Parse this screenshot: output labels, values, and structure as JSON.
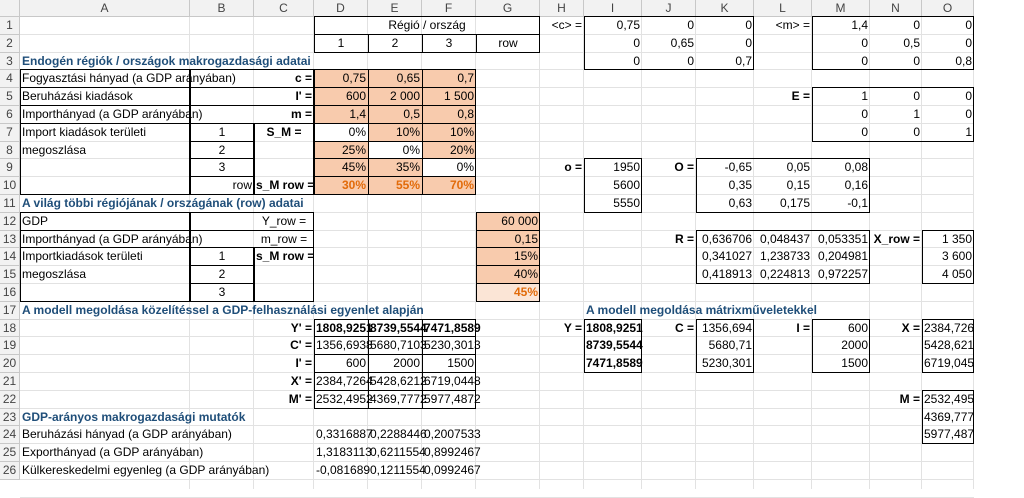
{
  "columns": [
    "A",
    "B",
    "C",
    "D",
    "E",
    "F",
    "G",
    "H",
    "I",
    "J",
    "K",
    "L",
    "M",
    "N",
    "O"
  ],
  "rows": [
    "1",
    "2",
    "3",
    "4",
    "5",
    "6",
    "7",
    "8",
    "9",
    "10",
    "11",
    "12",
    "13",
    "14",
    "15",
    "16",
    "17",
    "18",
    "19",
    "20",
    "21",
    "22",
    "23",
    "24",
    "25",
    "26"
  ],
  "colors": {
    "orange_fill": "#f8cbad",
    "light_orange_fill": "#fbe5d6",
    "title": "#1f4e79",
    "orange_text": "#e26b0a"
  },
  "cells": [
    {
      "ref": "D1",
      "text": "Régió / ország",
      "align": "c",
      "span": 4
    },
    {
      "ref": "D2",
      "text": "1",
      "align": "c"
    },
    {
      "ref": "E2",
      "text": "2",
      "align": "c"
    },
    {
      "ref": "F2",
      "text": "3",
      "align": "c"
    },
    {
      "ref": "G2",
      "text": "row",
      "align": "c"
    },
    {
      "ref": "H1",
      "text": "<c> =",
      "align": "r"
    },
    {
      "ref": "I1",
      "text": "0,75",
      "align": "r"
    },
    {
      "ref": "J1",
      "text": "0",
      "align": "r"
    },
    {
      "ref": "K1",
      "text": "0",
      "align": "r"
    },
    {
      "ref": "L1",
      "text": "<m> =",
      "align": "r"
    },
    {
      "ref": "M1",
      "text": "1,4",
      "align": "r"
    },
    {
      "ref": "N1",
      "text": "0",
      "align": "r"
    },
    {
      "ref": "O1",
      "text": "0",
      "align": "r"
    },
    {
      "ref": "I2",
      "text": "0",
      "align": "r"
    },
    {
      "ref": "J2",
      "text": "0,65",
      "align": "r"
    },
    {
      "ref": "K2",
      "text": "0",
      "align": "r"
    },
    {
      "ref": "M2",
      "text": "0",
      "align": "r"
    },
    {
      "ref": "N2",
      "text": "0,5",
      "align": "r"
    },
    {
      "ref": "O2",
      "text": "0",
      "align": "r"
    },
    {
      "ref": "A3",
      "text": "Endogén régiók / országok makrogazdasági adatai",
      "style": "t"
    },
    {
      "ref": "I3",
      "text": "0",
      "align": "r"
    },
    {
      "ref": "J3",
      "text": "0",
      "align": "r"
    },
    {
      "ref": "K3",
      "text": "0,7",
      "align": "r"
    },
    {
      "ref": "M3",
      "text": "0",
      "align": "r"
    },
    {
      "ref": "N3",
      "text": "0",
      "align": "r"
    },
    {
      "ref": "O3",
      "text": "0,8",
      "align": "r"
    },
    {
      "ref": "A4",
      "text": "Fogyasztási hányad (a GDP arányában)"
    },
    {
      "ref": "C4",
      "text": "c =",
      "align": "r",
      "style": "b"
    },
    {
      "ref": "D4",
      "text": "0,75",
      "align": "r"
    },
    {
      "ref": "E4",
      "text": "0,65",
      "align": "r"
    },
    {
      "ref": "F4",
      "text": "0,7",
      "align": "r"
    },
    {
      "ref": "A5",
      "text": "Beruházási kiadások"
    },
    {
      "ref": "C5",
      "text": "I' =",
      "align": "r",
      "style": "b"
    },
    {
      "ref": "D5",
      "text": "600",
      "align": "r"
    },
    {
      "ref": "E5",
      "text": "2 000",
      "align": "r"
    },
    {
      "ref": "F5",
      "text": "1 500",
      "align": "r"
    },
    {
      "ref": "L5",
      "text": "E =",
      "align": "r",
      "style": "b"
    },
    {
      "ref": "M5",
      "text": "1",
      "align": "r"
    },
    {
      "ref": "N5",
      "text": "0",
      "align": "r"
    },
    {
      "ref": "O5",
      "text": "0",
      "align": "r"
    },
    {
      "ref": "A6",
      "text": "Importhányad (a GDP arányában)"
    },
    {
      "ref": "C6",
      "text": "m =",
      "align": "r",
      "style": "b"
    },
    {
      "ref": "D6",
      "text": "1,4",
      "align": "r"
    },
    {
      "ref": "E6",
      "text": "0,5",
      "align": "r"
    },
    {
      "ref": "F6",
      "text": "0,8",
      "align": "r"
    },
    {
      "ref": "M6",
      "text": "0",
      "align": "r"
    },
    {
      "ref": "N6",
      "text": "1",
      "align": "r"
    },
    {
      "ref": "O6",
      "text": "0",
      "align": "r"
    },
    {
      "ref": "A7",
      "text": "Import kiadások területi"
    },
    {
      "ref": "B7",
      "text": "1",
      "align": "c"
    },
    {
      "ref": "C7",
      "text": "S_M =",
      "align": "c",
      "style": "b"
    },
    {
      "ref": "D7",
      "text": "0%",
      "align": "r"
    },
    {
      "ref": "E7",
      "text": "10%",
      "align": "r"
    },
    {
      "ref": "F7",
      "text": "10%",
      "align": "r"
    },
    {
      "ref": "M7",
      "text": "0",
      "align": "r"
    },
    {
      "ref": "N7",
      "text": "0",
      "align": "r"
    },
    {
      "ref": "O7",
      "text": "1",
      "align": "r"
    },
    {
      "ref": "A8",
      "text": "megoszlása"
    },
    {
      "ref": "B8",
      "text": "2",
      "align": "c"
    },
    {
      "ref": "D8",
      "text": "25%",
      "align": "r"
    },
    {
      "ref": "E8",
      "text": "0%",
      "align": "r"
    },
    {
      "ref": "F8",
      "text": "20%",
      "align": "r"
    },
    {
      "ref": "B9",
      "text": "3",
      "align": "c"
    },
    {
      "ref": "D9",
      "text": "45%",
      "align": "r"
    },
    {
      "ref": "E9",
      "text": "35%",
      "align": "r"
    },
    {
      "ref": "F9",
      "text": "0%",
      "align": "r"
    },
    {
      "ref": "H9",
      "text": "o =",
      "align": "r",
      "style": "b"
    },
    {
      "ref": "I9",
      "text": "1950",
      "align": "r"
    },
    {
      "ref": "J9",
      "text": "O =",
      "align": "r",
      "style": "b"
    },
    {
      "ref": "K9",
      "text": "-0,65",
      "align": "r"
    },
    {
      "ref": "L9",
      "text": "0,05",
      "align": "r"
    },
    {
      "ref": "M9",
      "text": "0,08",
      "align": "r"
    },
    {
      "ref": "B10",
      "text": "row",
      "align": "r"
    },
    {
      "ref": "C10",
      "text": "s_M row =",
      "align": "c",
      "style": "b"
    },
    {
      "ref": "D10",
      "text": "30%",
      "align": "r",
      "style": "o"
    },
    {
      "ref": "E10",
      "text": "55%",
      "align": "r",
      "style": "o"
    },
    {
      "ref": "F10",
      "text": "70%",
      "align": "r",
      "style": "o"
    },
    {
      "ref": "I10",
      "text": "5600",
      "align": "r"
    },
    {
      "ref": "K10",
      "text": "0,35",
      "align": "r"
    },
    {
      "ref": "L10",
      "text": "0,15",
      "align": "r"
    },
    {
      "ref": "M10",
      "text": "0,16",
      "align": "r"
    },
    {
      "ref": "A11",
      "text": "A világ többi régiójának / országának (row) adatai",
      "style": "t"
    },
    {
      "ref": "I11",
      "text": "5550",
      "align": "r"
    },
    {
      "ref": "K11",
      "text": "0,63",
      "align": "r"
    },
    {
      "ref": "L11",
      "text": "0,175",
      "align": "r"
    },
    {
      "ref": "M11",
      "text": "-0,1",
      "align": "r"
    },
    {
      "ref": "A12",
      "text": "GDP"
    },
    {
      "ref": "C12",
      "text": "Y_row =",
      "align": "c"
    },
    {
      "ref": "G12",
      "text": "60 000",
      "align": "r"
    },
    {
      "ref": "A13",
      "text": "Importhányad (a GDP arányában)"
    },
    {
      "ref": "C13",
      "text": "m_row =",
      "align": "c"
    },
    {
      "ref": "G13",
      "text": "0,15",
      "align": "r"
    },
    {
      "ref": "J13",
      "text": "R =",
      "align": "r",
      "style": "b"
    },
    {
      "ref": "K13",
      "text": "0,636706",
      "align": "r"
    },
    {
      "ref": "L13",
      "text": "0,048437",
      "align": "r"
    },
    {
      "ref": "M13",
      "text": "0,053351",
      "align": "r"
    },
    {
      "ref": "N13",
      "text": "X_row =",
      "align": "r",
      "style": "b"
    },
    {
      "ref": "O13",
      "text": "1 350",
      "align": "r"
    },
    {
      "ref": "A14",
      "text": "Importkiadások területi"
    },
    {
      "ref": "B14",
      "text": "1",
      "align": "c"
    },
    {
      "ref": "C14",
      "text": "s_M row =",
      "align": "c",
      "style": "b"
    },
    {
      "ref": "G14",
      "text": "15%",
      "align": "r"
    },
    {
      "ref": "K14",
      "text": "0,341027",
      "align": "r"
    },
    {
      "ref": "L14",
      "text": "1,238733",
      "align": "r"
    },
    {
      "ref": "M14",
      "text": "0,204981",
      "align": "r"
    },
    {
      "ref": "O14",
      "text": "3 600",
      "align": "r"
    },
    {
      "ref": "A15",
      "text": "megoszlása"
    },
    {
      "ref": "B15",
      "text": "2",
      "align": "c"
    },
    {
      "ref": "G15",
      "text": "40%",
      "align": "r"
    },
    {
      "ref": "K15",
      "text": "0,418913",
      "align": "r"
    },
    {
      "ref": "L15",
      "text": "0,224813",
      "align": "r"
    },
    {
      "ref": "M15",
      "text": "0,972257",
      "align": "r"
    },
    {
      "ref": "O15",
      "text": "4 050",
      "align": "r"
    },
    {
      "ref": "B16",
      "text": "3",
      "align": "c"
    },
    {
      "ref": "G16",
      "text": "45%",
      "align": "r",
      "style": "o"
    },
    {
      "ref": "A17",
      "text": "A modell megoldása közelítéssel a GDP-felhasználási egyenlet alapján",
      "style": "t"
    },
    {
      "ref": "I17",
      "text": "A modell megoldása mátrixműveletekkel",
      "style": "t"
    },
    {
      "ref": "C18",
      "text": "Y' =",
      "align": "r",
      "style": "b"
    },
    {
      "ref": "D18",
      "text": "1808,9251",
      "align": "r",
      "style": "b"
    },
    {
      "ref": "E18",
      "text": "8739,5544",
      "align": "r",
      "style": "b"
    },
    {
      "ref": "F18",
      "text": "7471,8589",
      "align": "r",
      "style": "b"
    },
    {
      "ref": "H18",
      "text": "Y =",
      "align": "r",
      "style": "b"
    },
    {
      "ref": "I18",
      "text": "1808,9251",
      "align": "r",
      "style": "b"
    },
    {
      "ref": "J18",
      "text": "C =",
      "align": "r",
      "style": "b"
    },
    {
      "ref": "K18",
      "text": "1356,694",
      "align": "r"
    },
    {
      "ref": "L18",
      "text": "I =",
      "align": "r",
      "style": "b"
    },
    {
      "ref": "M18",
      "text": "600",
      "align": "r"
    },
    {
      "ref": "N18",
      "text": "X =",
      "align": "r",
      "style": "b"
    },
    {
      "ref": "O18",
      "text": "2384,726",
      "align": "r"
    },
    {
      "ref": "C19",
      "text": "C' =",
      "align": "r",
      "style": "b"
    },
    {
      "ref": "D19",
      "text": "1356,6938",
      "align": "r"
    },
    {
      "ref": "E19",
      "text": "5680,7103",
      "align": "r"
    },
    {
      "ref": "F19",
      "text": "5230,3013",
      "align": "r"
    },
    {
      "ref": "I19",
      "text": "8739,5544",
      "align": "r",
      "style": "b"
    },
    {
      "ref": "K19",
      "text": "5680,71",
      "align": "r"
    },
    {
      "ref": "M19",
      "text": "2000",
      "align": "r"
    },
    {
      "ref": "O19",
      "text": "5428,621",
      "align": "r"
    },
    {
      "ref": "C20",
      "text": "I' =",
      "align": "r",
      "style": "b"
    },
    {
      "ref": "D20",
      "text": "600",
      "align": "r"
    },
    {
      "ref": "E20",
      "text": "2000",
      "align": "r"
    },
    {
      "ref": "F20",
      "text": "1500",
      "align": "r"
    },
    {
      "ref": "I20",
      "text": "7471,8589",
      "align": "r",
      "style": "b"
    },
    {
      "ref": "K20",
      "text": "5230,301",
      "align": "r"
    },
    {
      "ref": "M20",
      "text": "1500",
      "align": "r"
    },
    {
      "ref": "O20",
      "text": "6719,045",
      "align": "r"
    },
    {
      "ref": "C21",
      "text": "X' =",
      "align": "r",
      "style": "b"
    },
    {
      "ref": "D21",
      "text": "2384,7264",
      "align": "r"
    },
    {
      "ref": "E21",
      "text": "5428,6212",
      "align": "r"
    },
    {
      "ref": "F21",
      "text": "6719,0448",
      "align": "r"
    },
    {
      "ref": "C22",
      "text": "M' =",
      "align": "r",
      "style": "b"
    },
    {
      "ref": "D22",
      "text": "2532,4952",
      "align": "r"
    },
    {
      "ref": "E22",
      "text": "4369,7772",
      "align": "r"
    },
    {
      "ref": "F22",
      "text": "5977,4872",
      "align": "r"
    },
    {
      "ref": "N22",
      "text": "M =",
      "align": "r",
      "style": "b"
    },
    {
      "ref": "O22",
      "text": "2532,495",
      "align": "r"
    },
    {
      "ref": "A23",
      "text": "GDP-arányos makrogazdasági mutatók",
      "style": "t"
    },
    {
      "ref": "O23",
      "text": "4369,777",
      "align": "r"
    },
    {
      "ref": "A24",
      "text": "Beruházási hányad (a GDP arányában)"
    },
    {
      "ref": "D24",
      "text": "0,3316887",
      "align": "r"
    },
    {
      "ref": "E24",
      "text": "0,2288446",
      "align": "r"
    },
    {
      "ref": "F24",
      "text": "0,2007533",
      "align": "r"
    },
    {
      "ref": "O24",
      "text": "5977,487",
      "align": "r"
    },
    {
      "ref": "A25",
      "text": "Exporthányad (a GDP arányában)"
    },
    {
      "ref": "D25",
      "text": "1,3183113",
      "align": "r"
    },
    {
      "ref": "E25",
      "text": "0,6211554",
      "align": "r"
    },
    {
      "ref": "F25",
      "text": "0,8992467",
      "align": "r"
    },
    {
      "ref": "A26",
      "text": "Külkereskedelmi egyenleg (a GDP arányában)"
    },
    {
      "ref": "D26",
      "text": "-0,081689",
      "align": "r"
    },
    {
      "ref": "E26",
      "text": "0,1211554",
      "align": "r"
    },
    {
      "ref": "F26",
      "text": "0,0992467",
      "align": "r"
    }
  ]
}
